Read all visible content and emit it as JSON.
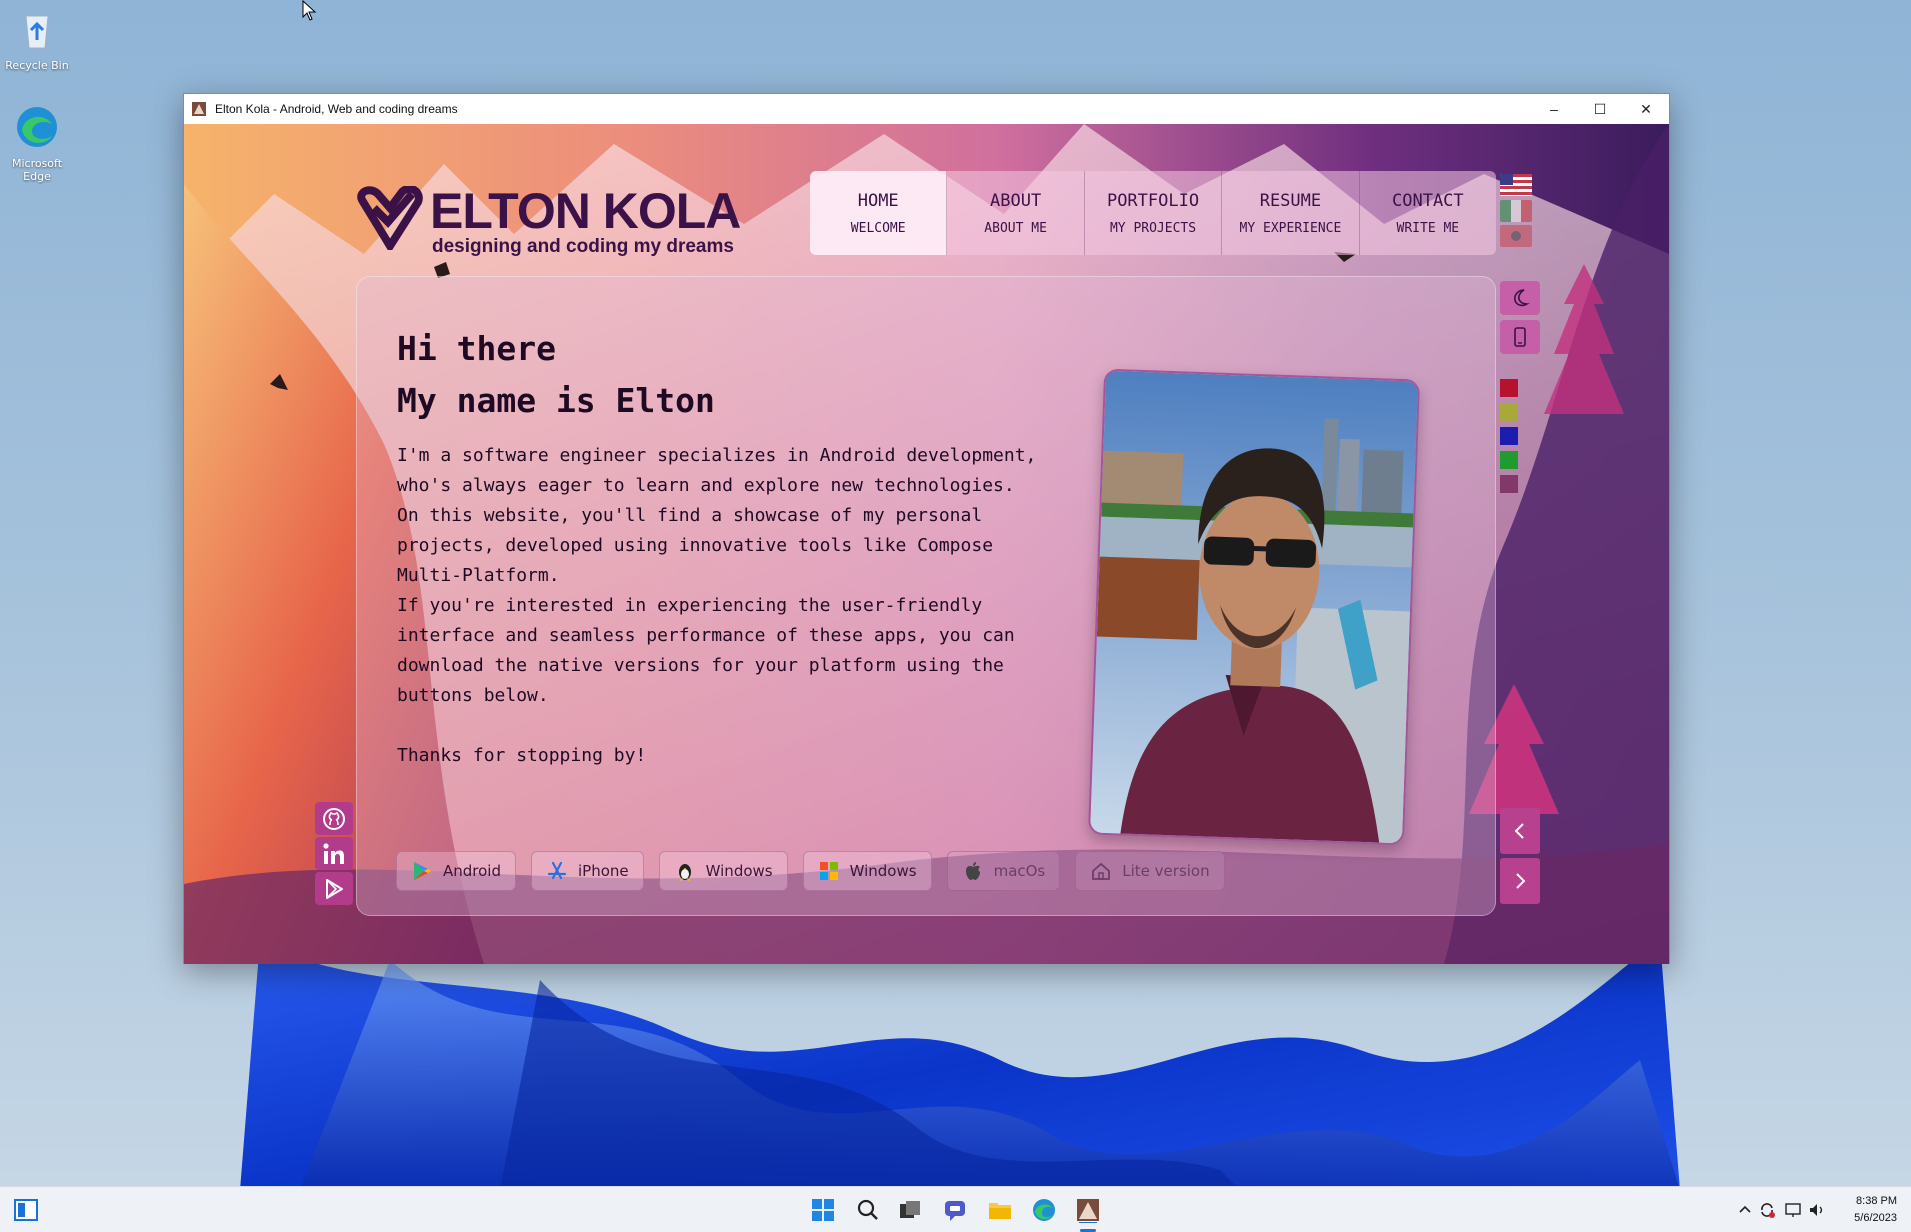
{
  "desktop": {
    "icons": [
      {
        "label": "Recycle Bin",
        "icon": "recycle-bin-icon"
      },
      {
        "label": "Microsoft Edge",
        "icon": "edge-icon"
      }
    ]
  },
  "window": {
    "title": "Elton Kola - Android, Web and coding dreams",
    "controls": {
      "minimize": "–",
      "maximize": "☐",
      "close": "✕"
    }
  },
  "site": {
    "logo": {
      "name": "ELTON KOLA",
      "tagline": "designing and coding my dreams"
    },
    "nav": [
      {
        "label": "HOME",
        "sub": "WELCOME",
        "active": true
      },
      {
        "label": "ABOUT",
        "sub": "ABOUT ME",
        "active": false
      },
      {
        "label": "PORTFOLIO",
        "sub": "MY PROJECTS",
        "active": false
      },
      {
        "label": "RESUME",
        "sub": "MY EXPERIENCE",
        "active": false
      },
      {
        "label": "CONTACT",
        "sub": "WRITE ME",
        "active": false
      }
    ],
    "languages": [
      "us-flag-icon",
      "it-flag-icon",
      "al-flag-icon"
    ],
    "greeting_line1": "Hi there",
    "greeting_line2": "My name is Elton",
    "bio": [
      "I'm a software engineer specializes in Android development, who's always eager to learn and explore new technologies.",
      "On this website, you'll find a showcase of my personal projects, developed using innovative tools like Compose Multi-Platform.",
      "If you're interested in experiencing the user-friendly interface and seamless performance of these apps, you can download the native versions for your platform using the buttons below."
    ],
    "thanks": "Thanks for stopping by!",
    "downloads": [
      {
        "label": "Android",
        "icon": "google-play-icon"
      },
      {
        "label": "iPhone",
        "icon": "app-store-icon"
      },
      {
        "label": "Windows",
        "icon": "linux-tux-icon"
      },
      {
        "label": "Windows",
        "icon": "windows-logo-icon"
      },
      {
        "label": "macOs",
        "icon": "apple-icon"
      },
      {
        "label": "Lite version",
        "icon": "home-icon"
      }
    ],
    "social": [
      "github-icon",
      "linkedin-icon",
      "google-play-icon"
    ],
    "theme_colors": [
      "#b5122f",
      "#a9a83a",
      "#1c1caf",
      "#1f9b2f",
      "#6a1a4f"
    ]
  },
  "taskbar": {
    "time": "8:38 PM",
    "date": "5/6/2023"
  }
}
